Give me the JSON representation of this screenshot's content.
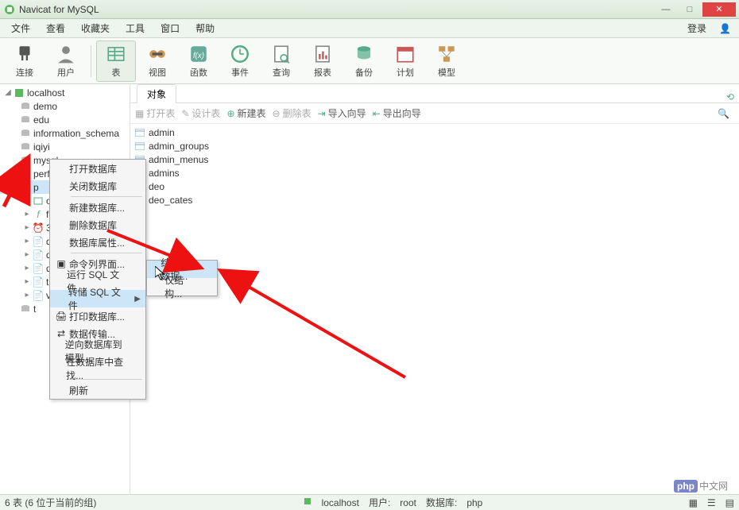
{
  "window": {
    "title": "Navicat for MySQL"
  },
  "menubar": {
    "items": [
      "文件",
      "查看",
      "收藏夹",
      "工具",
      "窗口",
      "帮助"
    ],
    "login": "登录"
  },
  "toolbar": {
    "items": [
      {
        "label": "连接",
        "icon": "plug"
      },
      {
        "label": "用户",
        "icon": "user"
      },
      {
        "sep": true
      },
      {
        "label": "表",
        "icon": "table",
        "active": true
      },
      {
        "label": "视图",
        "icon": "view"
      },
      {
        "label": "函数",
        "icon": "fx"
      },
      {
        "label": "事件",
        "icon": "event"
      },
      {
        "label": "查询",
        "icon": "query"
      },
      {
        "label": "报表",
        "icon": "report"
      },
      {
        "label": "备份",
        "icon": "backup"
      },
      {
        "label": "计划",
        "icon": "schedule"
      },
      {
        "label": "模型",
        "icon": "model"
      }
    ]
  },
  "tree": {
    "connection": "localhost",
    "databases": [
      "demo",
      "edu",
      "information_schema",
      "iqiyi",
      "mysql",
      "performance_schema"
    ],
    "selected_db": "p",
    "sub": {
      "tables_label": "oo",
      "folders": [
        "f",
        "3",
        "q",
        "q",
        "q",
        "t",
        "v",
        "t"
      ]
    }
  },
  "tab": {
    "label": "对象"
  },
  "objbar": {
    "items": [
      {
        "label": "打开表",
        "disabled": true,
        "icon": "open"
      },
      {
        "label": "设计表",
        "disabled": true,
        "icon": "design"
      },
      {
        "label": "新建表",
        "icon": "new"
      },
      {
        "label": "删除表",
        "disabled": true,
        "icon": "delete"
      },
      {
        "label": "导入向导",
        "icon": "import"
      },
      {
        "label": "导出向导",
        "icon": "export"
      }
    ]
  },
  "tables": [
    "admin",
    "admin_groups",
    "admin_menus",
    "admins",
    "deo",
    "deo_cates"
  ],
  "ctx1": {
    "items": [
      {
        "label": "打开数据库"
      },
      {
        "label": "关闭数据库"
      },
      {
        "sep": true
      },
      {
        "label": "新建数据库..."
      },
      {
        "label": "删除数据库"
      },
      {
        "label": "数据库属性..."
      },
      {
        "sep": true
      },
      {
        "label": "命令列界面...",
        "icon": "cmd"
      },
      {
        "label": "运行 SQL 文件..."
      },
      {
        "label": "转储 SQL 文件",
        "hl": true,
        "sub": true
      },
      {
        "label": "打印数据库...",
        "icon": "print"
      },
      {
        "label": "数据传输...",
        "icon": "transfer"
      },
      {
        "label": "逆向数据库到模型..."
      },
      {
        "label": "在数据库中查找..."
      },
      {
        "sep": true
      },
      {
        "label": "刷新"
      }
    ]
  },
  "ctx2": {
    "items": [
      {
        "label": "结构和数据...",
        "hl": true
      },
      {
        "label": "仅结构..."
      }
    ]
  },
  "statusbar": {
    "left": "6 表 (6 位于当前的组)",
    "conn": "localhost",
    "user_label": "用户:",
    "user": "root",
    "db_label": "数据库:",
    "db": "php"
  },
  "watermark": "中文网"
}
